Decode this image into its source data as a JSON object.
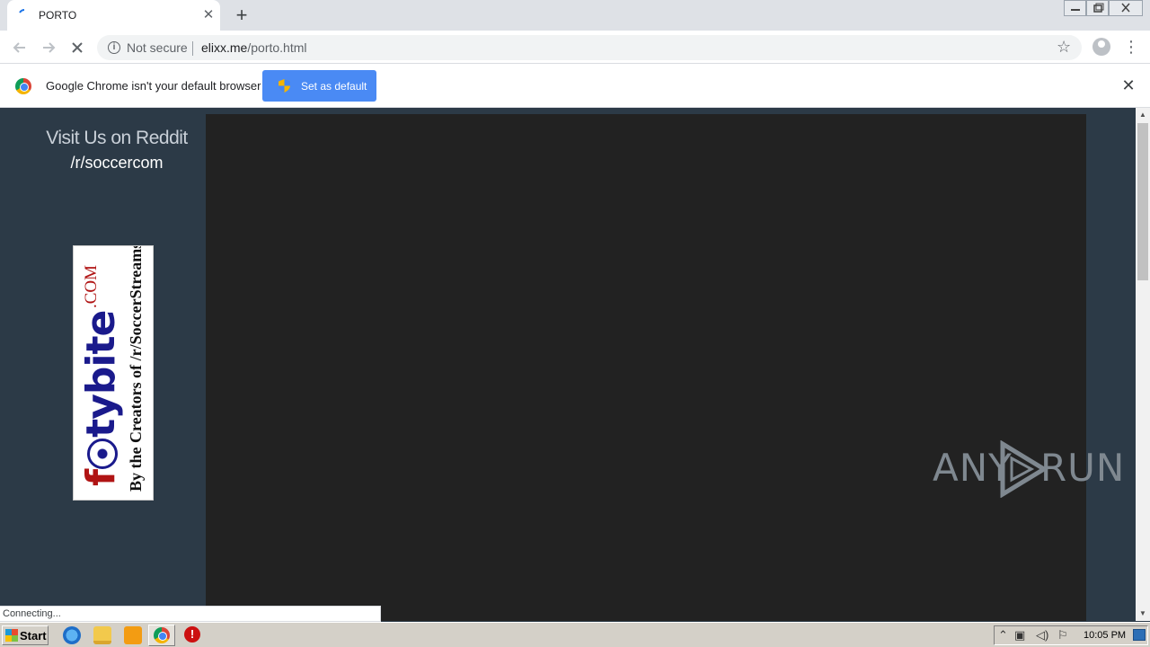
{
  "browser": {
    "tab_title": "PORTO",
    "tab_close": "✕",
    "new_tab": "+",
    "security_label": "Not secure",
    "url_domain": "elixx.me",
    "url_path": "/porto.html"
  },
  "infobar": {
    "message": "Google Chrome isn't your default browser",
    "button_label": "Set as default",
    "close": "✕"
  },
  "page": {
    "reddit_heading": "Visit Us on Reddit",
    "reddit_link": "/r/soccercom",
    "banner": {
      "brand_first": "f",
      "brand_rest": "tybite",
      "brand_suffix": ".COM",
      "tagline": "By the Creators of /r/SoccerStreams"
    },
    "watermark_left": "ANY",
    "watermark_right": "RUN"
  },
  "status_text": "Connecting...",
  "taskbar": {
    "start_label": "Start",
    "clock": "10:05 PM"
  },
  "colors": {
    "page_bg": "#2c3a47",
    "player_bg": "#222222",
    "button_blue": "#4a8af4"
  }
}
